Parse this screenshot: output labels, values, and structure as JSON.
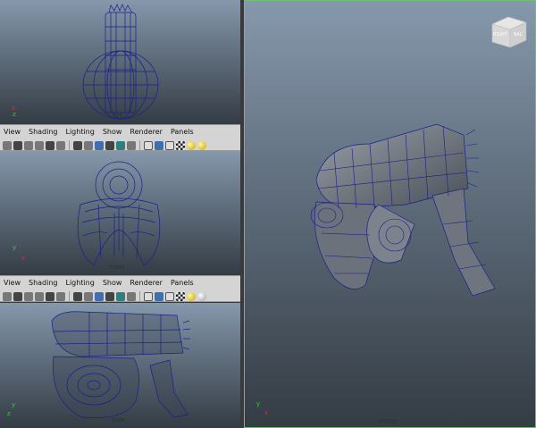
{
  "menus": [
    "View",
    "Shading",
    "Lighting",
    "Show",
    "Renderer",
    "Panels"
  ],
  "viewports": {
    "top": {
      "label": "top"
    },
    "front": {
      "label": "front"
    },
    "side": {
      "label": "side"
    },
    "persp": {
      "label": "persp"
    }
  },
  "viewcube": {
    "left_face": "RIGHT",
    "right_face": "BAC"
  },
  "axes": {
    "x": "x",
    "y": "y",
    "z": "z"
  },
  "colors": {
    "wire": "#1a1f8a",
    "active_border": "#6cc06c"
  }
}
